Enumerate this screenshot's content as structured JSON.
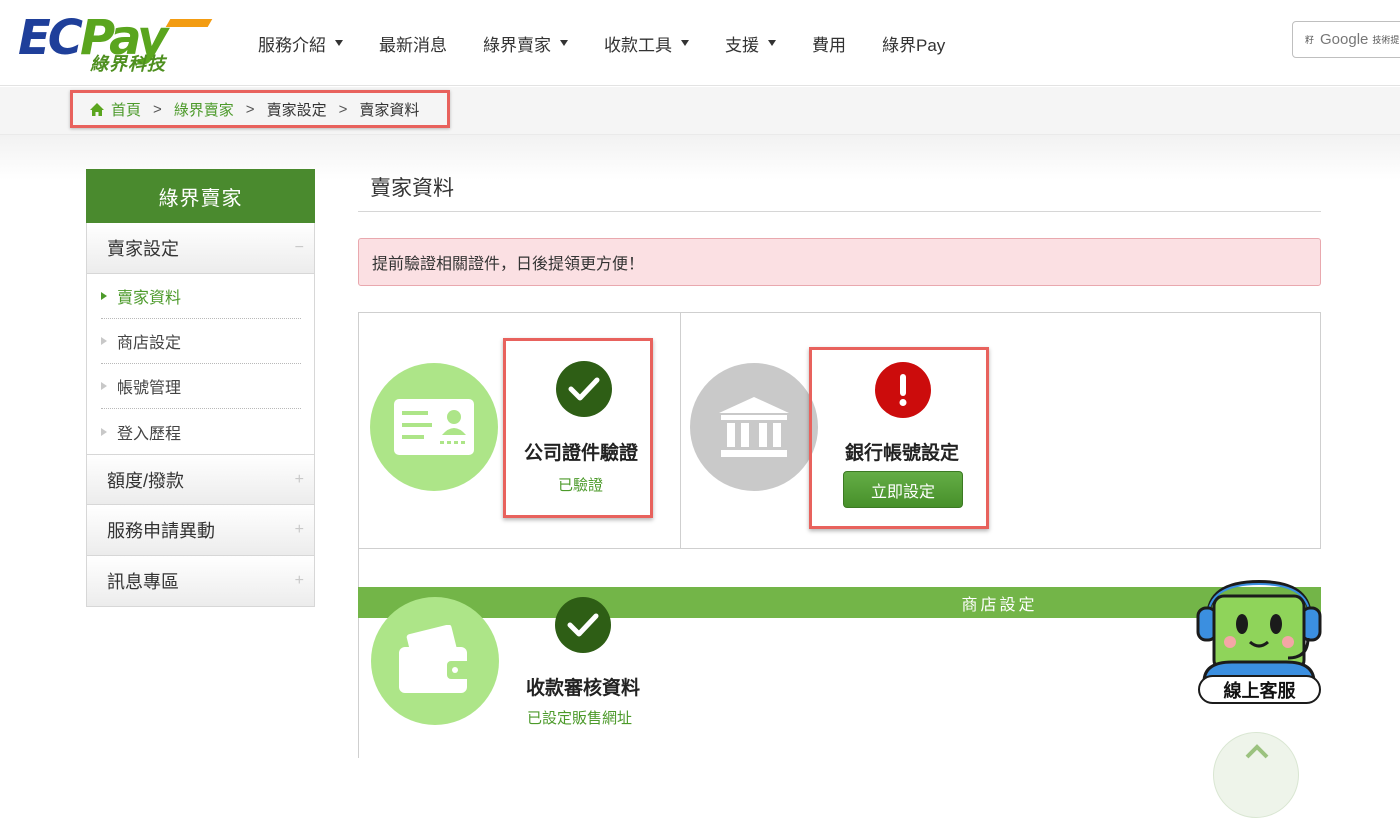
{
  "header": {
    "logo": {
      "main_ec": "EC",
      "main_pay": "Pay",
      "sub": "綠界科技"
    },
    "nav": [
      {
        "label": "服務介紹",
        "has_dropdown": true
      },
      {
        "label": "最新消息",
        "has_dropdown": false
      },
      {
        "label": "綠界賣家",
        "has_dropdown": true
      },
      {
        "label": "收款工具",
        "has_dropdown": true
      },
      {
        "label": "支援",
        "has_dropdown": true
      },
      {
        "label": "費用",
        "has_dropdown": false
      },
      {
        "label": "綠界Pay",
        "has_dropdown": false
      }
    ],
    "translate": {
      "prefix": "籽",
      "brand": "Google",
      "suffix": "技術提"
    }
  },
  "breadcrumb": {
    "items": [
      "首頁",
      "綠界賣家",
      "賣家設定",
      "賣家資料"
    ],
    "separator": ">"
  },
  "sidebar": {
    "title": "綠界賣家",
    "groups": [
      {
        "label": "賣家設定",
        "sign": "−",
        "items": [
          {
            "label": "賣家資料"
          },
          {
            "label": "商店設定"
          },
          {
            "label": "帳號管理"
          },
          {
            "label": "登入歷程"
          }
        ]
      },
      {
        "label": "額度/撥款",
        "sign": "+"
      },
      {
        "label": "服務申請異動",
        "sign": "+"
      },
      {
        "label": "訊息專區",
        "sign": "+"
      }
    ]
  },
  "main": {
    "title": "賣家資料",
    "alert": "提前驗證相關證件，日後提領更方便！",
    "cards": {
      "company": {
        "title": "公司證件驗證",
        "status": "已驗證",
        "icon": "id-card-icon",
        "status_icon": "checkmark-icon"
      },
      "bank": {
        "title": "銀行帳號設定",
        "button": "立即設定",
        "icon": "bank-icon",
        "status_icon": "exclamation-icon"
      }
    },
    "store_section": {
      "band_label": "商店設定",
      "payment_review": {
        "title": "收款審核資料",
        "status": "已設定販售網址",
        "icon": "wallet-icon",
        "status_icon": "checkmark-icon"
      }
    }
  },
  "support": {
    "label": "線上客服"
  },
  "colors": {
    "brand_green": "#4a8a2e",
    "link_green": "#4c9a2a",
    "alert_bg": "#fbe0e3",
    "highlight_red": "#e8625d",
    "ok_dark_green": "#2e5e15",
    "warn_red": "#cc0c0c"
  }
}
